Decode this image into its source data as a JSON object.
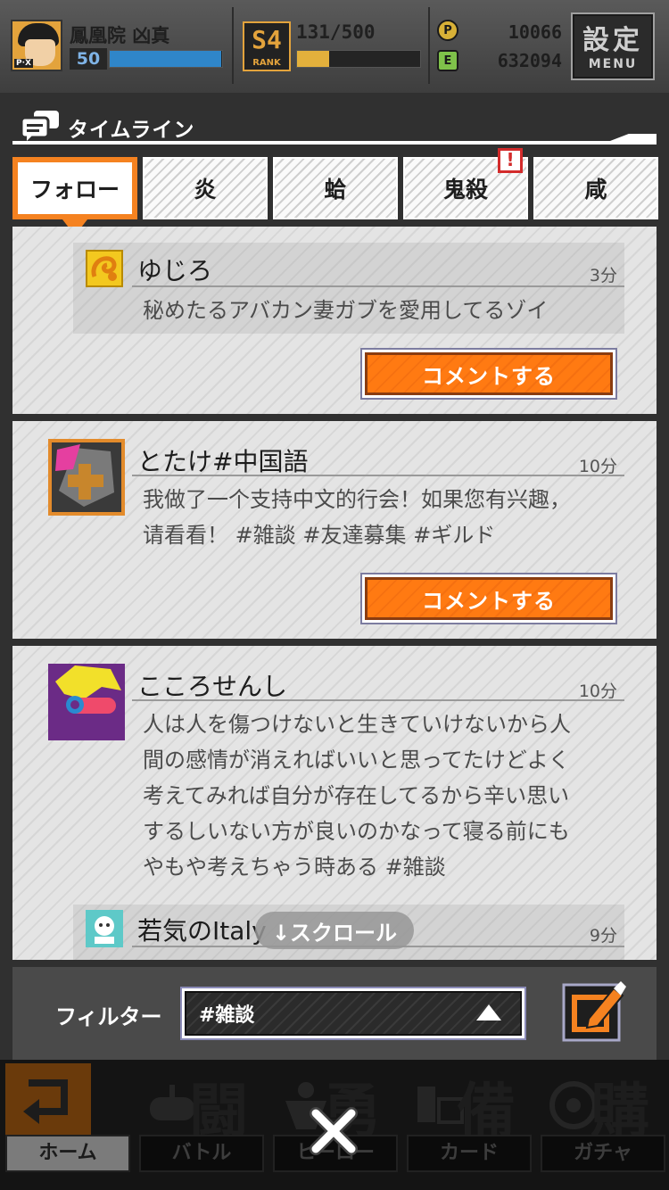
{
  "player": {
    "name": "鳳凰院 凶真",
    "level": "50",
    "xp_fraction": 0.99,
    "rank_number": "S4",
    "rank_word": "RANK",
    "stamina_text": "131/500",
    "stamina_fraction": 0.26,
    "coin_p_symbol": "P",
    "coin_p_value": "10066",
    "coin_e_symbol": "E",
    "coin_e_value": "632094",
    "avatar_corner": "P·X"
  },
  "settings": {
    "label": "設定",
    "sub": "MENU"
  },
  "timeline": {
    "title": "タイムライン",
    "icon": "chat-bubbles-icon"
  },
  "tabs": [
    {
      "label": "フォロー",
      "active": true
    },
    {
      "label": "炎",
      "active": false
    },
    {
      "label": "蛤",
      "active": false
    },
    {
      "label": "鬼殺",
      "active": false,
      "alert": "!"
    },
    {
      "label": "咸",
      "active": false
    }
  ],
  "posts": [
    {
      "author": "ゆじろ",
      "time": "3分",
      "body": "秘めたるアバカン妻ガブを愛用してるゾイ",
      "comment_label": "コメントする"
    },
    {
      "author": "とたけ#中国語",
      "time": "10分",
      "body_lines": [
        "我做了一个支持中文的行会！如果您有兴趣，",
        "请看看！ #雑談 #友達募集 #ギルド"
      ],
      "comment_label": "コメントする"
    },
    {
      "author": "こころせんし",
      "time": "10分",
      "body_lines": [
        "人は人を傷つけないと生きていけないから人",
        "間の感情が消えればいいと思ってたけどよく",
        "考えてみれば自分が存在してるから辛い思い",
        "するしいない方が良いのかなって寝る前にも",
        "やもや考えちゃう時ある #雑談"
      ],
      "reply_author": "若気のItaly",
      "reply_time": "9分"
    }
  ],
  "scroll_hint": "↓スクロール",
  "filter": {
    "label": "フィルター",
    "value": "#雑談"
  },
  "nav": [
    {
      "label": "ホーム",
      "glyph": ""
    },
    {
      "label": "バトル",
      "glyph": "闘"
    },
    {
      "label": "ヒーロー",
      "glyph": "勇"
    },
    {
      "label": "カード",
      "glyph": "備"
    },
    {
      "label": "ガチャ",
      "glyph": "購"
    }
  ],
  "colors": {
    "accent": "#f58220",
    "alert": "#d32b2b",
    "xp": "#2f86c9",
    "stamina": "#e3b03c"
  }
}
